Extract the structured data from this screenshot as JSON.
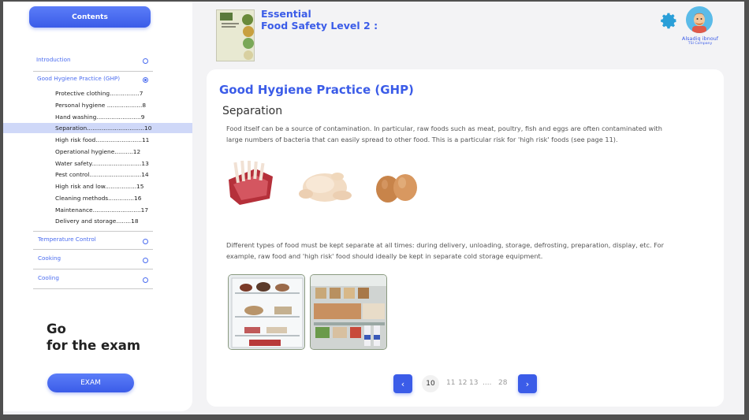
{
  "sidebar": {
    "contents_label": "Contents",
    "sections": [
      {
        "label": "Introduction",
        "selected": false
      },
      {
        "label": "Good Hygiene Practice (GHP)",
        "selected": true
      },
      {
        "label": "Temperature Control",
        "selected": false
      },
      {
        "label": "Cooking",
        "selected": false
      },
      {
        "label": "Cooling",
        "selected": false
      }
    ],
    "subitems": [
      {
        "label": "Protective clothing................7",
        "active": false
      },
      {
        "label": "Personal hygiene ...................8",
        "active": false
      },
      {
        "label": "Hand washing........................9",
        "active": false
      },
      {
        "label": "Separation...............................10",
        "active": true
      },
      {
        "label": "High risk food.........................11",
        "active": false
      },
      {
        "label": "Operational hygiene..........12",
        "active": false
      },
      {
        "label": "Water safety...........................13",
        "active": false
      },
      {
        "label": "Pest control............................14",
        "active": false
      },
      {
        "label": "High risk and low.................15",
        "active": false
      },
      {
        "label": "Cleaning methods..............16",
        "active": false
      },
      {
        "label": "Maintenance..........................17",
        "active": false
      },
      {
        "label": "Delivery and storage........18",
        "active": false
      }
    ],
    "go_exam_line1": "Go",
    "go_exam_line2": "for the exam",
    "exam_button": "EXAM"
  },
  "header": {
    "book_title_line1": "Essential",
    "book_title_line2": "Food Safety Level 2 :",
    "user_name": "Alsadiq ibnouf",
    "user_company": "TSI Company",
    "settings_icon": "gear-icon"
  },
  "main": {
    "section_title": "Good Hygiene Practice (GHP)",
    "subtitle": "Separation",
    "paragraph1": "Food itself can be a source of contamination. In particular, raw foods such as meat, poultry, fish and eggs are often contaminated with large numbers of bacteria that can easily spread to other food. This is a particular risk for 'high risk' foods (see page 11).",
    "paragraph2": "Different types of food must be kept separate at all times: during delivery, unloading, storage, defrosting, preparation, display, etc. For example, raw food and 'high risk' food should ideally be kept in separate cold storage equipment."
  },
  "pagination": {
    "prev": "‹",
    "next": "›",
    "current": "10",
    "pages": [
      "11",
      "12",
      "13",
      "....",
      "28"
    ]
  },
  "colors": {
    "accent": "#3b5ce8",
    "active_row": "#cfd8f8"
  }
}
